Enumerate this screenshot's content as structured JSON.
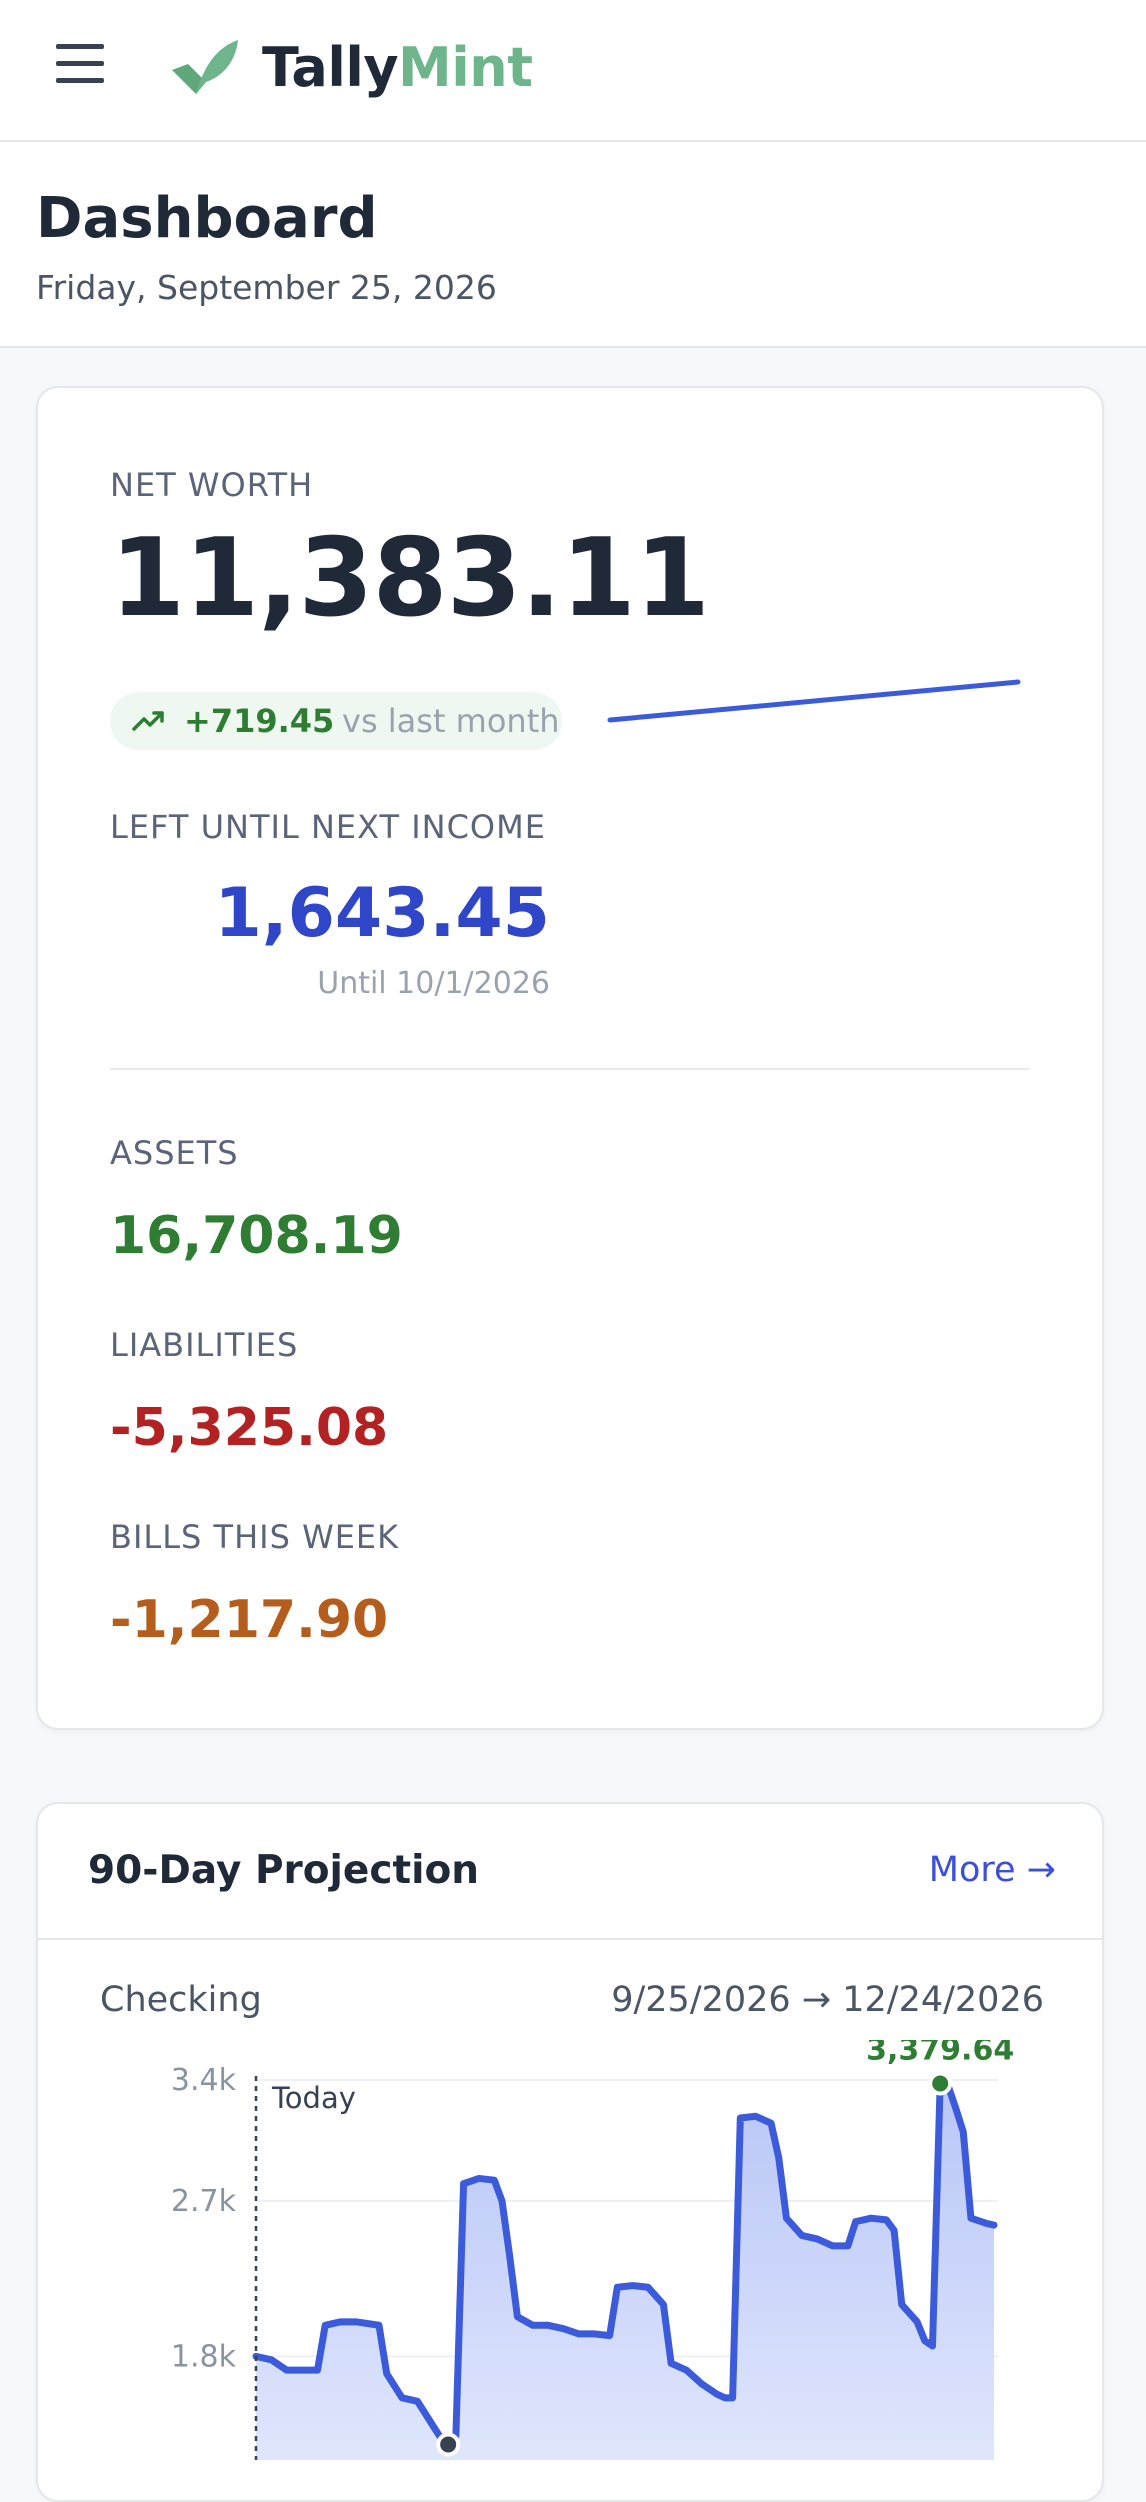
{
  "header": {
    "brand_part1": "Tally",
    "brand_part2": "Mint",
    "menu_icon": "hamburger-icon",
    "logo_icon": "leaf-check-icon"
  },
  "page": {
    "title": "Dashboard",
    "date": "Friday, September 25, 2026"
  },
  "net_worth": {
    "label": "NET WORTH",
    "value": "11,383.11",
    "delta_icon": "trend-up-icon",
    "delta": "+719.45",
    "delta_suffix": "vs last month",
    "left_until_label": "LEFT UNTIL NEXT INCOME",
    "left_until_value": "1,643.45",
    "until_text": "Until 10/1/2026",
    "assets_label": "ASSETS",
    "assets_value": "16,708.19",
    "liabilities_label": "LIABILITIES",
    "liabilities_value": "-5,325.08",
    "bills_label": "BILLS THIS WEEK",
    "bills_value": "-1,217.90"
  },
  "projection": {
    "title": "90-Day Projection",
    "more": "More →",
    "account": "Checking",
    "range": "9/25/2026 → 12/24/2026",
    "today_label": "Today",
    "peak_label": "3,379.64"
  },
  "colors": {
    "brand_green": "#6fb58c",
    "positive": "#2e7d32",
    "negative": "#b22222",
    "bills": "#b55d1c",
    "accent_blue": "#3046c9",
    "chart_line": "#3b5bdb"
  },
  "chart_data": [
    {
      "type": "line",
      "title": "",
      "x": [
        0,
        1
      ],
      "values": [
        10663.66,
        11383.11
      ],
      "grid": false
    },
    {
      "type": "area",
      "title": "90-Day Projection",
      "xlabel": "",
      "ylabel": "",
      "yticks": [
        "1.8k",
        "2.7k",
        "3.4k"
      ],
      "ytick_values": [
        1800,
        2700,
        3400
      ],
      "ylim": [
        1200,
        3400
      ],
      "x_range": [
        "9/25/2026",
        "12/24/2026"
      ],
      "grid": true,
      "series": [
        {
          "name": "Checking",
          "points": [
            [
              0,
              1800
            ],
            [
              2,
              1780
            ],
            [
              4,
              1720
            ],
            [
              6,
              1720
            ],
            [
              8,
              1720
            ],
            [
              9,
              1980
            ],
            [
              11,
              2000
            ],
            [
              13,
              2000
            ],
            [
              16,
              1980
            ],
            [
              17,
              1700
            ],
            [
              19,
              1560
            ],
            [
              21,
              1540
            ],
            [
              23,
              1400
            ],
            [
              24,
              1330
            ],
            [
              25,
              1290
            ],
            [
              26,
              1340
            ],
            [
              27,
              2800
            ],
            [
              29,
              2830
            ],
            [
              31,
              2820
            ],
            [
              32,
              2700
            ],
            [
              33,
              2380
            ],
            [
              34,
              2030
            ],
            [
              36,
              1980
            ],
            [
              38,
              1980
            ],
            [
              40,
              1960
            ],
            [
              42,
              1930
            ],
            [
              44,
              1930
            ],
            [
              46,
              1920
            ],
            [
              47,
              2200
            ],
            [
              49,
              2210
            ],
            [
              51,
              2200
            ],
            [
              53,
              2100
            ],
            [
              54,
              1760
            ],
            [
              56,
              1720
            ],
            [
              58,
              1640
            ],
            [
              60,
              1580
            ],
            [
              61,
              1560
            ],
            [
              62,
              1560
            ],
            [
              63,
              3180
            ],
            [
              65,
              3190
            ],
            [
              67,
              3150
            ],
            [
              68,
              2950
            ],
            [
              69,
              2600
            ],
            [
              71,
              2500
            ],
            [
              73,
              2480
            ],
            [
              75,
              2440
            ],
            [
              77,
              2440
            ],
            [
              78,
              2580
            ],
            [
              80,
              2600
            ],
            [
              82,
              2590
            ],
            [
              83,
              2530
            ],
            [
              84,
              2100
            ],
            [
              86,
              2000
            ],
            [
              87,
              1890
            ],
            [
              88,
              1860
            ],
            [
              89,
              3379.64
            ],
            [
              90,
              3370
            ],
            [
              91,
              3240
            ],
            [
              92,
              3100
            ],
            [
              93,
              2600
            ],
            [
              95,
              2570
            ],
            [
              96,
              2560
            ]
          ]
        }
      ],
      "today_x": 0,
      "min_point_x": 25,
      "peak_x": 89,
      "peak_value": 3379.64
    }
  ]
}
